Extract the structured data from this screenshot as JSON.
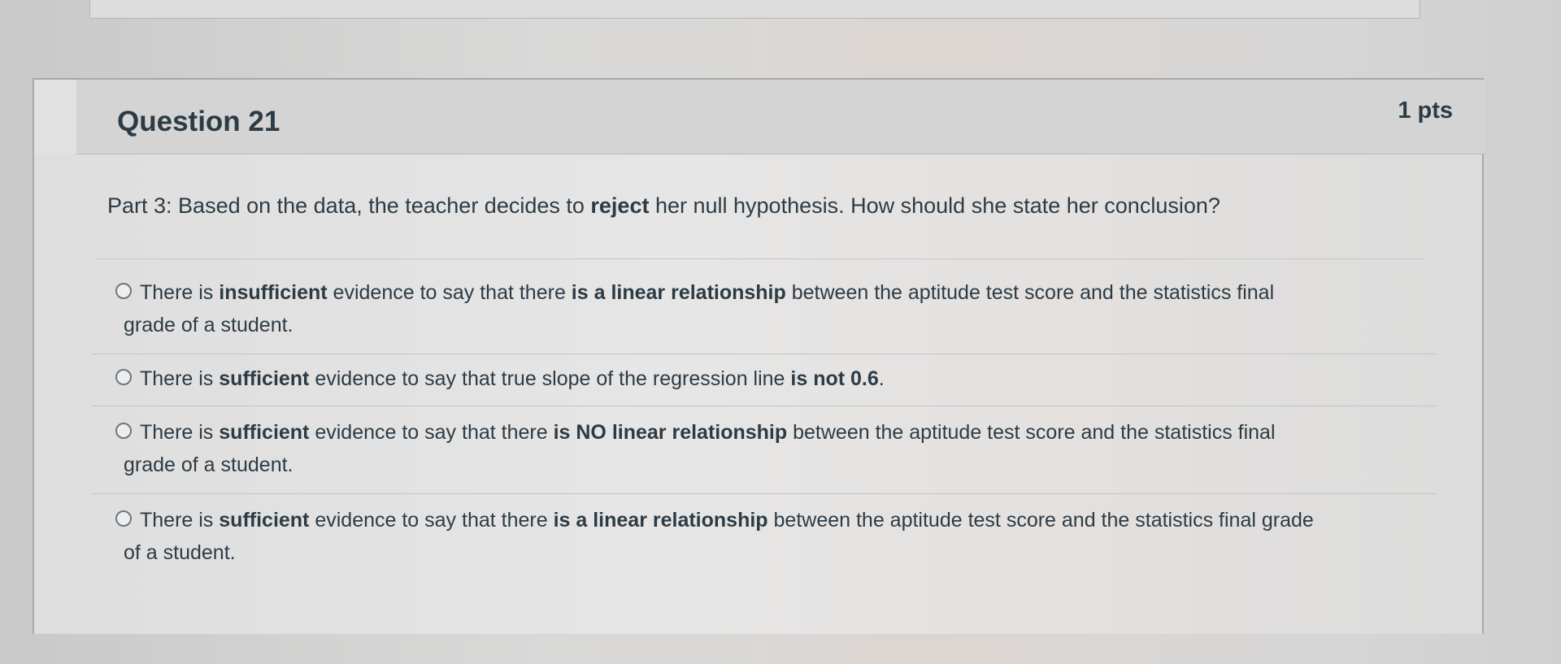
{
  "question": {
    "title": "Question 21",
    "points": "1 pts",
    "prompt": {
      "prefix": "Part 3: Based on the data, the teacher decides to ",
      "bold": "reject",
      "suffix": " her null hypothesis. How should she state her conclusion?"
    },
    "answers": [
      {
        "p1": "There is ",
        "b1": "insufficient",
        "p2": " evidence to say that there ",
        "b2": "is a linear relationship",
        "p3": " between the aptitude test score and the statistics final",
        "line2": "grade of a student."
      },
      {
        "p1": "There is ",
        "b1": "sufficient",
        "p2": " evidence to say that true slope of the regression line ",
        "b2": "is not 0.6",
        "p3": ".",
        "line2": ""
      },
      {
        "p1": "There is ",
        "b1": "sufficient",
        "p2": " evidence to say that there ",
        "b2": "is NO linear relationship",
        "p3": " between the aptitude test score and the statistics final",
        "line2": "grade of a student."
      },
      {
        "p1": "There is ",
        "b1": "sufficient",
        "p2": " evidence to say that there ",
        "b2": "is a linear relationship",
        "p3": " between the aptitude test score and the statistics final grade",
        "line2": "of a student."
      }
    ]
  },
  "icons": {
    "flag": "bookmark-flag-icon",
    "radio": "radio-button-icon"
  },
  "colors": {
    "text": "#2d3b45",
    "header_bg": "#d4d4d4",
    "body_bg": "#e1e1e1",
    "border": "#a8a8a8"
  }
}
